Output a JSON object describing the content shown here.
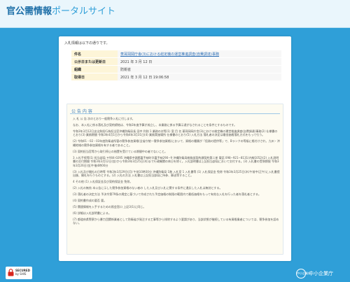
{
  "header": {
    "title_main": "官公需情報",
    "title_sub": "ポータルサイト"
  },
  "panel": {
    "intro": "入札情報は以下の通りです。"
  },
  "info_table": [
    {
      "label": "件名",
      "value": "菱耳岡岡庁舎(3)における総定機の運営推進調査(自費調達)事務",
      "is_link": true
    },
    {
      "label": "公示日または更新日",
      "value": "2021 年 3 月 12 日",
      "is_link": false
    },
    {
      "label": "組織",
      "value": "防衛省",
      "is_link": false
    },
    {
      "label": "取得日",
      "value": "2021 年 3 月 12 日 19:06:58",
      "is_link": false
    }
  ],
  "notice": {
    "title": "公 告 内 容",
    "paragraphs": [
      "入 札 公 告 次のとおり一般競争入札に付します。",
      "なお、本入札に係る落札及び契約締結は、令和3年度予算が成立し、本業務に係る予算示達がなされることを条件とするものです。",
      "令和3年3月12日支出負担行為担当官沖縄防衛局長 田中 利則 1 業務の対等(1) 案 目 名 菱耳岡岡庁舎(3)における総定機の運営推進調査(自費調達)事務(2) 仕様書のとおり(3) 業務期間 令和3年4月1日から令和4年3月31日(4) 業務実施場所 仕様書のとおり(5) 入札方法 落札者の決定は最低価格落札方式をもって行う。",
      "(2) 令和01・02・03年度防衛省所管の競争参加資格(全省庁統一競争参加資格)において、資格の種類が「役務の提供等」で、Bランクの等級に格付けされ、九州・沖縄地域の競争参加資格を有する者であること。",
      "(3) 契約担当官等から取引停止の措置を受けている期間中の者でないこと。",
      "3 入札手続等(1) 担当部局 〒904-0295 沖縄県中頭郡嘉手納町字嘉手納290−9 沖縄防衛局総務部契約課契約第二係 電話 098−921−8131(内線1052)(2) 入札説明書の交付期間 令和3年3月12日(金)から令和3年3月25日(木)まで行政機関の休日を除く。入札説明書は上記担当部局において交付する。(3) 入札書の受領期限 令和3年3月26日(金)午後4時00分",
      "(3) 入札及び開札の日時等 令和3年3月29日(月) 午前10時30分 沖縄防衛局 1階 入札室 1 入札書等 (1) 入札保証金 免除 令和3年3月25日(木)午前中(正午)に入札書提出後、開札を行うものとする。(2) 入札の方法 入札書は上記担当部局に持参、郵送等すること。",
      "4 その他 (1) 入札保証金及び契約保証金 免除。",
      "(2) 入札の無効 本公告に示した競争参加資格のない者の した入札及び入札に関する条件に違反した入札は無効とする。",
      "(3) 落札者の決定方法 予決令第79条の規定に基づいて作成された予定価格の制限の範囲内で最低価格をもって有効な入札を行った者を落札者とする。",
      "(4) 契約書作成の要否 要。",
      "(5) 関連情報を入手するための照会窓口 上記3(1)に同じ。",
      "(6) 詳細は入札説明書による。",
      "(7) 都道府県警察から暴力団関係業者として防衛省が発注する工事等から排除するよう要請があり、当該状態が継続している有資格業者については、競争参加を認めない。"
    ]
  },
  "footer": {
    "secure_line1": "SECURED",
    "secure_line2": "by SHIS",
    "agency_icon_text": "中小企業庁",
    "agency_name": "中小企業庁"
  }
}
